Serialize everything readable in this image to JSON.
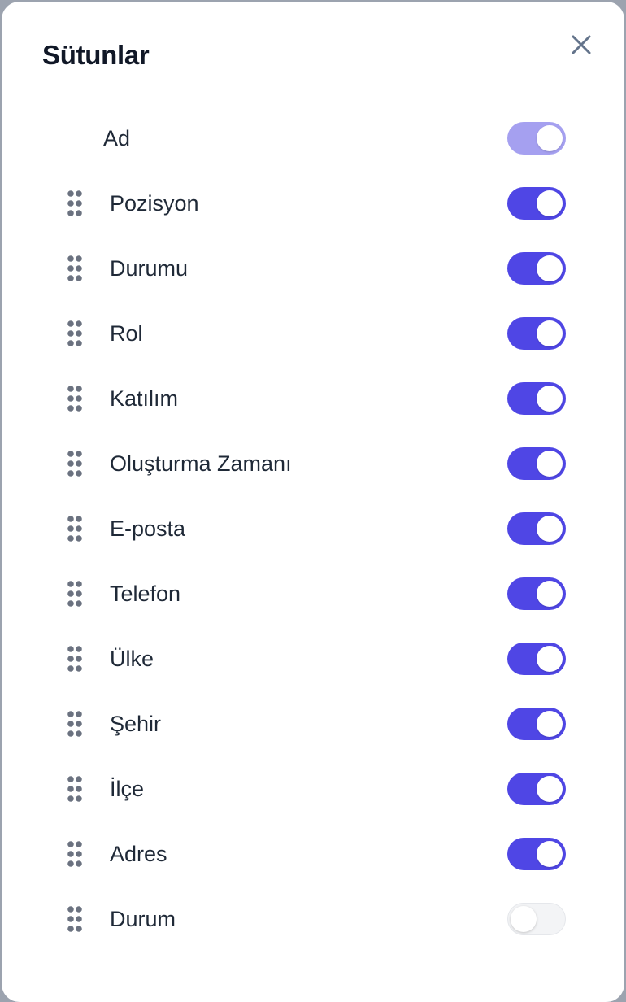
{
  "dialog": {
    "title": "Sütunlar",
    "close_icon": "close-icon"
  },
  "colors": {
    "toggle_on": "#4f46e5",
    "toggle_disabled": "#a5a0f0",
    "toggle_off": "#f3f4f6",
    "handle": "#6b7280"
  },
  "columns": [
    {
      "label": "Ad",
      "enabled": true,
      "locked": true
    },
    {
      "label": "Pozisyon",
      "enabled": true,
      "locked": false
    },
    {
      "label": "Durumu",
      "enabled": true,
      "locked": false
    },
    {
      "label": "Rol",
      "enabled": true,
      "locked": false
    },
    {
      "label": "Katılım",
      "enabled": true,
      "locked": false
    },
    {
      "label": "Oluşturma Zamanı",
      "enabled": true,
      "locked": false
    },
    {
      "label": "E-posta",
      "enabled": true,
      "locked": false
    },
    {
      "label": "Telefon",
      "enabled": true,
      "locked": false
    },
    {
      "label": "Ülke",
      "enabled": true,
      "locked": false
    },
    {
      "label": "Şehir",
      "enabled": true,
      "locked": false
    },
    {
      "label": "İlçe",
      "enabled": true,
      "locked": false
    },
    {
      "label": "Adres",
      "enabled": true,
      "locked": false
    },
    {
      "label": "Durum",
      "enabled": false,
      "locked": false
    }
  ]
}
